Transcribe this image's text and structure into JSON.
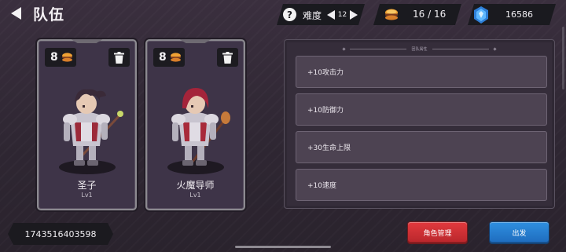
{
  "header": {
    "title": "队伍",
    "back_icon": "back-arrow-icon"
  },
  "difficulty": {
    "label": "难度",
    "value": "12",
    "help_icon": "help-icon"
  },
  "food": {
    "value": "16 / 16",
    "icon": "food-icon"
  },
  "gems": {
    "value": "16586",
    "icon": "gem-icon"
  },
  "heroes": [
    {
      "name": "圣子",
      "level": "Lv1",
      "cost": "8",
      "hair_color": "#3a2a38"
    },
    {
      "name": "火魔导师",
      "level": "Lv1",
      "cost": "8",
      "hair_color": "#a4243a"
    }
  ],
  "team_attributes": {
    "title": "团队属性",
    "rows": [
      "+10攻击力",
      "+10防御力",
      "+30生命上限",
      "+10速度"
    ]
  },
  "footer": {
    "player_id": "1743516403598",
    "manage_label": "角色管理",
    "depart_label": "出发"
  },
  "colors": {
    "manage_button": "#d3302f",
    "depart_button": "#2a86d6",
    "gem": "#4aa8f0",
    "food": "#e08a2a"
  }
}
